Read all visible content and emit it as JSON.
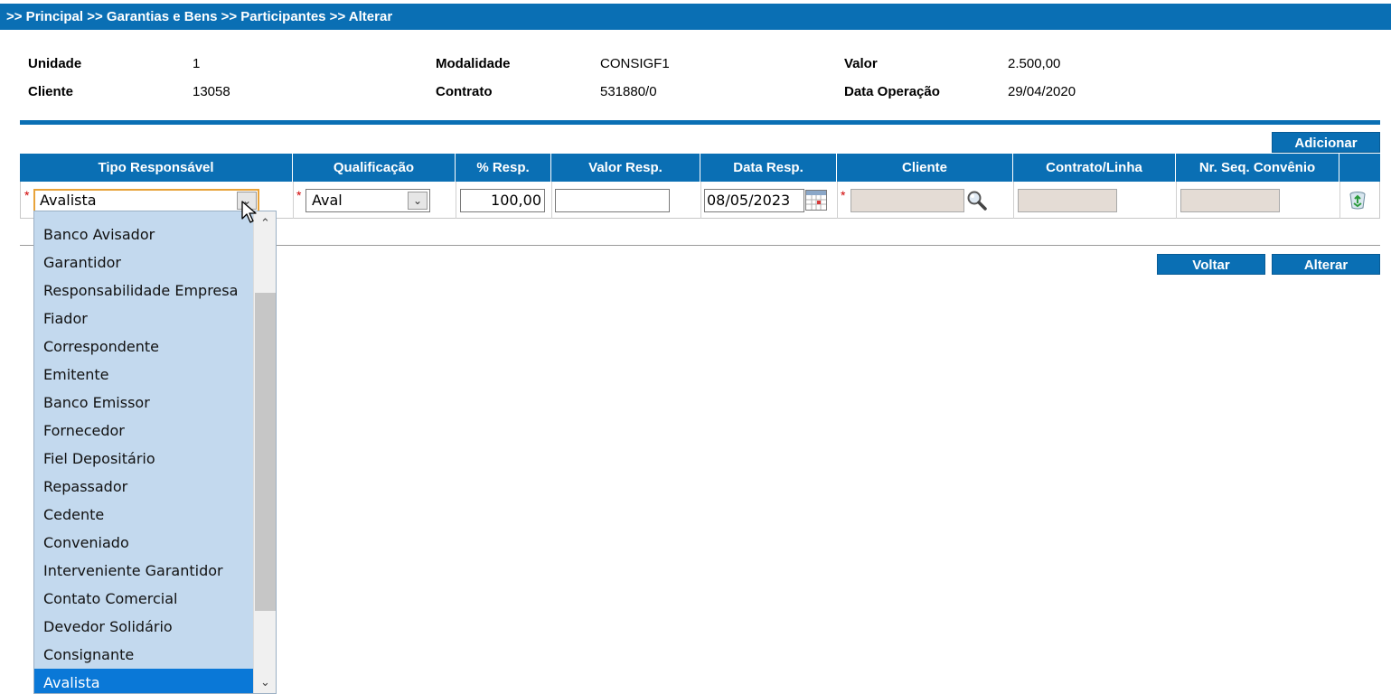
{
  "breadcrumb": ">> Principal >> Garantias e Bens >> Participantes >> Alterar",
  "info": {
    "unidade_label": "Unidade",
    "unidade_value": "1",
    "cliente_label": "Cliente",
    "cliente_value": "13058",
    "modalidade_label": "Modalidade",
    "modalidade_value": "CONSIGF1",
    "contrato_label": "Contrato",
    "contrato_value": "531880/0",
    "valor_label": "Valor",
    "valor_value": "2.500,00",
    "data_operacao_label": "Data Operação",
    "data_operacao_value": "29/04/2020"
  },
  "buttons": {
    "adicionar": "Adicionar",
    "voltar": "Voltar",
    "alterar": "Alterar"
  },
  "table": {
    "headers": [
      "Tipo Responsável",
      "Qualificação",
      "% Resp.",
      "Valor Resp.",
      "Data Resp.",
      "Cliente",
      "Contrato/Linha",
      "Nr. Seq. Convênio"
    ],
    "row": {
      "required_mark": "*",
      "tipo_responsavel": "Avalista",
      "qualificacao": "Aval",
      "perc_resp": "100,00",
      "valor_resp": "",
      "data_resp": "08/05/2023",
      "cliente": "",
      "contrato_linha": "",
      "nr_seq_convenio": ""
    }
  },
  "dropdown": {
    "options": [
      "Banco Avisador",
      "Garantidor",
      "Responsabilidade Empresa",
      "Fiador",
      "Correspondente",
      "Emitente",
      "Banco Emissor",
      "Fornecedor",
      "Fiel Depositário",
      "Repassador",
      "Cedente",
      "Conveniado",
      "Interveniente Garantidor",
      "Contato Comercial",
      "Devedor Solidário",
      "Consignante",
      "Avalista"
    ],
    "selected": "Avalista"
  },
  "icons": {
    "calendar": "calendar-icon",
    "search": "magnifier-icon",
    "delete": "recycle-bin-icon",
    "dropdown": "chevron-down-icon"
  },
  "colors": {
    "primary": "#0a6fb4",
    "selected": "#0a78d7",
    "dropdown_bg": "#c3d9ee",
    "required": "#d00000"
  }
}
